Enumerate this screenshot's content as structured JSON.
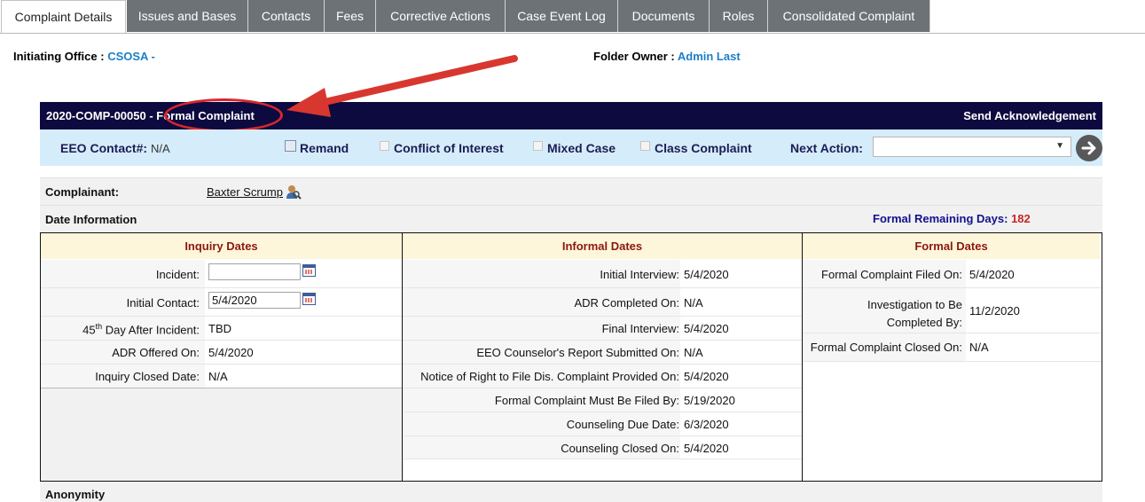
{
  "tabs": [
    "Complaint Details",
    "Issues and Bases",
    "Contacts",
    "Fees",
    "Corrective Actions",
    "Case Event Log",
    "Documents",
    "Roles",
    "Consolidated Complaint"
  ],
  "initiating_office": {
    "label": "Initiating Office :",
    "value": "CSOSA -"
  },
  "folder_owner": {
    "label": "Folder Owner :",
    "value": "Admin Last"
  },
  "header": {
    "case_number": "2020-COMP-00050 - ",
    "case_type": "Formal Complaint",
    "send_ack": "Send Acknowledgement"
  },
  "subbar": {
    "eeo_contact_label": "EEO Contact#:",
    "eeo_contact_value": "N/A",
    "remand": "Remand",
    "conflict": "Conflict of Interest",
    "mixed": "Mixed Case",
    "class": "Class Complaint",
    "next_action": "Next Action:"
  },
  "complainant": {
    "label": "Complainant:",
    "name": "Baxter Scrump"
  },
  "date_info": {
    "label": "Date Information",
    "remaining_label": "Formal Remaining Days:",
    "remaining_value": "182"
  },
  "inquiry": {
    "heading": "Inquiry Dates",
    "incident_label": "Incident:",
    "incident_value": "",
    "initial_contact_label": "Initial Contact:",
    "initial_contact_value": "5/4/2020",
    "day45_prefix": "45",
    "day45_sup": "th",
    "day45_suffix": " Day After Incident:",
    "day45_value": "TBD",
    "adr_offered_label": "ADR Offered On:",
    "adr_offered_value": "5/4/2020",
    "closed_label": "Inquiry Closed Date:",
    "closed_value": "N/A"
  },
  "informal": {
    "heading": "Informal Dates",
    "rows": [
      {
        "label": "Initial Interview:",
        "value": "5/4/2020"
      },
      {
        "label": "ADR Completed On:",
        "value": "N/A"
      },
      {
        "label": "Final Interview:",
        "value": "5/4/2020"
      },
      {
        "label": "EEO Counselor's Report Submitted On:",
        "value": "N/A"
      },
      {
        "label": "Notice of Right to File Dis. Complaint Provided On:",
        "value": "5/4/2020"
      },
      {
        "label": "Formal Complaint Must Be Filed By:",
        "value": "5/19/2020"
      },
      {
        "label": "Counseling Due Date:",
        "value": "6/3/2020"
      },
      {
        "label": "Counseling Closed On:",
        "value": "5/4/2020"
      }
    ]
  },
  "formal": {
    "heading": "Formal Dates",
    "filed_label": "Formal Complaint Filed On:",
    "filed_value": "5/4/2020",
    "investigation_label_1": "Investigation to Be",
    "investigation_label_2": "Completed By:",
    "investigation_value": "11/2/2020",
    "closed_label": "Formal Complaint Closed On:",
    "closed_value": "N/A"
  },
  "anonymity": {
    "label": "Anonymity"
  },
  "colors": {
    "header_bg": "#0d0a3f",
    "subbar_bg": "#d5ecfa",
    "tab_bg": "#6d7277",
    "link": "#1b7fc7",
    "heading_red": "#8b1810",
    "annotation_red": "#d8272c"
  },
  "icons": [
    "person-lookup-icon",
    "calendar-icon",
    "arrow-right-icon",
    "dropdown-arrow-icon",
    "annotation-arrow"
  ]
}
